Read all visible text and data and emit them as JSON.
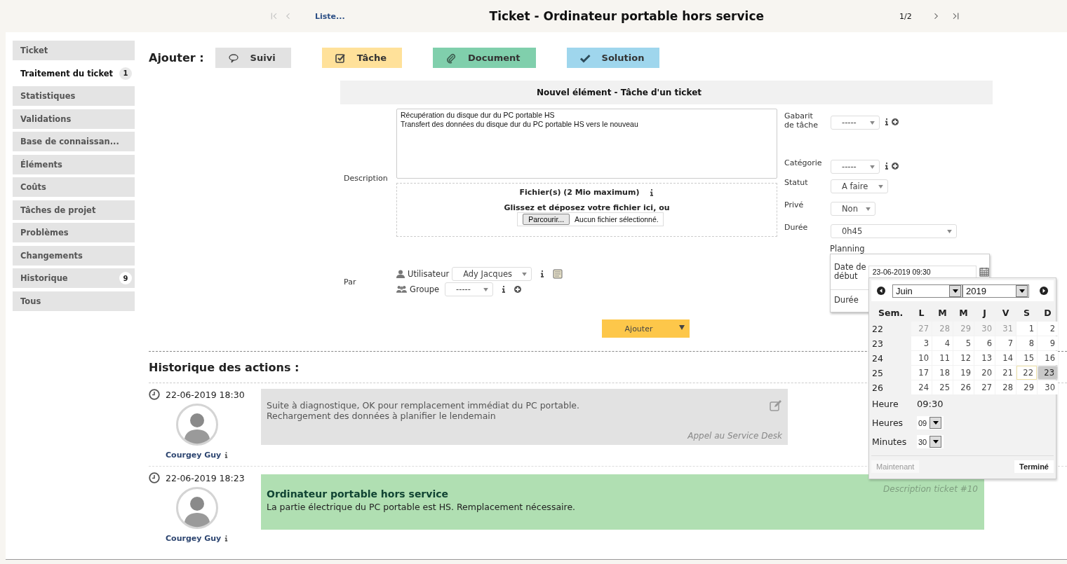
{
  "header": {
    "nav_left": [
      {
        "kind": "first",
        "disabled": true
      },
      {
        "kind": "prev",
        "disabled": true
      }
    ],
    "list_link": "Liste...",
    "title": "Ticket - Ordinateur portable hors service",
    "counter": "1/2",
    "nav_right": [
      {
        "kind": "next",
        "disabled": false
      },
      {
        "kind": "last",
        "disabled": false
      }
    ]
  },
  "sidebar": {
    "items": [
      {
        "label": "Ticket",
        "selected": false
      },
      {
        "label": "Traitement du ticket",
        "badge": "1",
        "selected": true
      },
      {
        "label": "Statistiques",
        "selected": false
      },
      {
        "label": "Validations",
        "selected": false
      },
      {
        "label": "Base de connaissan...",
        "selected": false
      },
      {
        "label": "Éléments",
        "selected": false
      },
      {
        "label": "Coûts",
        "selected": false
      },
      {
        "label": "Tâches de projet",
        "selected": false
      },
      {
        "label": "Problèmes",
        "selected": false
      },
      {
        "label": "Changements",
        "selected": false
      },
      {
        "label": "Historique",
        "badge": "9",
        "selected": false
      },
      {
        "label": "Tous",
        "selected": false
      }
    ]
  },
  "add_bar": {
    "label": "Ajouter :",
    "buttons": [
      {
        "label": "Suivi",
        "kind": "followup",
        "color": "#e2e2e2"
      },
      {
        "label": "Tâche",
        "kind": "task",
        "color": "#ffe19a"
      },
      {
        "label": "Document",
        "kind": "document",
        "color": "#80cfac"
      },
      {
        "label": "Solution",
        "kind": "solution",
        "color": "#9fd6ed"
      }
    ]
  },
  "form": {
    "title": "Nouvel élément - Tâche d'un ticket",
    "description_label": "Description",
    "description": "Récupération du disque dur du PC portable HS\nTransfert des données du disque dur du PC portable HS vers le nouveau",
    "files_title": "Fichier(s) (2 Mio maximum)",
    "drop_text": "Glissez et déposez votre fichier ici, ou",
    "browse_button": "Parcourir...",
    "no_file": "Aucun fichier sélectionné.",
    "by_label": "Par",
    "user_label": "Utilisateur",
    "user_value": "Ady Jacques",
    "group_label": "Groupe",
    "group_value": "-----",
    "fields": [
      {
        "label": "Gabarit de tâche",
        "value": "-----",
        "info": true,
        "add": true
      },
      {
        "label": "Catégorie",
        "value": "-----",
        "info": true,
        "add": true
      },
      {
        "label": "Statut",
        "value": "A faire",
        "info": false,
        "add": false
      },
      {
        "label": "Privé",
        "value": "Non",
        "info": false,
        "add": false
      },
      {
        "label": "Durée",
        "value": "0h45",
        "info": false,
        "add": false
      }
    ],
    "planning_label": "Planning",
    "start_label": "Date de début",
    "start_value": "23-06-2019 09:30",
    "duration_label": "Durée",
    "submit": "Ajouter"
  },
  "calendar": {
    "month": "Juin",
    "year": "2019",
    "headers": [
      "Sem.",
      "L",
      "M",
      "M",
      "J",
      "V",
      "S",
      "D"
    ],
    "weeks": [
      {
        "number": "22",
        "days": [
          {
            "label": "27",
            "other": true,
            "today": false,
            "selected": false
          },
          {
            "label": "28",
            "other": true,
            "today": false,
            "selected": false
          },
          {
            "label": "29",
            "other": true,
            "today": false,
            "selected": false
          },
          {
            "label": "30",
            "other": true,
            "today": false,
            "selected": false
          },
          {
            "label": "31",
            "other": true,
            "today": false,
            "selected": false
          },
          {
            "label": "1",
            "other": false,
            "today": false,
            "selected": false
          },
          {
            "label": "2",
            "other": false,
            "today": false,
            "selected": false
          }
        ]
      },
      {
        "number": "23",
        "days": [
          {
            "label": "3",
            "other": false,
            "today": false,
            "selected": false
          },
          {
            "label": "4",
            "other": false,
            "today": false,
            "selected": false
          },
          {
            "label": "5",
            "other": false,
            "today": false,
            "selected": false
          },
          {
            "label": "6",
            "other": false,
            "today": false,
            "selected": false
          },
          {
            "label": "7",
            "other": false,
            "today": false,
            "selected": false
          },
          {
            "label": "8",
            "other": false,
            "today": false,
            "selected": false
          },
          {
            "label": "9",
            "other": false,
            "today": false,
            "selected": false
          }
        ]
      },
      {
        "number": "24",
        "days": [
          {
            "label": "10",
            "other": false,
            "today": false,
            "selected": false
          },
          {
            "label": "11",
            "other": false,
            "today": false,
            "selected": false
          },
          {
            "label": "12",
            "other": false,
            "today": false,
            "selected": false
          },
          {
            "label": "13",
            "other": false,
            "today": false,
            "selected": false
          },
          {
            "label": "14",
            "other": false,
            "today": false,
            "selected": false
          },
          {
            "label": "15",
            "other": false,
            "today": false,
            "selected": false
          },
          {
            "label": "16",
            "other": false,
            "today": false,
            "selected": false
          }
        ]
      },
      {
        "number": "25",
        "days": [
          {
            "label": "17",
            "other": false,
            "today": false,
            "selected": false
          },
          {
            "label": "18",
            "other": false,
            "today": false,
            "selected": false
          },
          {
            "label": "19",
            "other": false,
            "today": false,
            "selected": false
          },
          {
            "label": "20",
            "other": false,
            "today": false,
            "selected": false
          },
          {
            "label": "21",
            "other": false,
            "today": false,
            "selected": false
          },
          {
            "label": "22",
            "other": false,
            "today": true,
            "selected": false
          },
          {
            "label": "23",
            "other": false,
            "today": false,
            "selected": true
          }
        ]
      },
      {
        "number": "26",
        "days": [
          {
            "label": "24",
            "other": false,
            "today": false,
            "selected": false
          },
          {
            "label": "25",
            "other": false,
            "today": false,
            "selected": false
          },
          {
            "label": "26",
            "other": false,
            "today": false,
            "selected": false
          },
          {
            "label": "27",
            "other": false,
            "today": false,
            "selected": false
          },
          {
            "label": "28",
            "other": false,
            "today": false,
            "selected": false
          },
          {
            "label": "29",
            "other": false,
            "today": false,
            "selected": false
          },
          {
            "label": "30",
            "other": false,
            "today": false,
            "selected": false
          }
        ]
      }
    ],
    "time_label": "Heure",
    "time": "09:30",
    "hours_label": "Heures",
    "hours": "09",
    "minutes_label": "Minutes",
    "minutes": "30",
    "now_button": "Maintenant",
    "done_button": "Terminé"
  },
  "history": {
    "title": "Historique des actions :",
    "entries": [
      {
        "kind": "followup",
        "date": "22-06-2019 18:30",
        "author": "Courgey Guy",
        "text": "Suite à diagnostique, OK pour remplacement immédiat du PC portable.\nRechargement des données à planifier le lendemain",
        "footer": "Appel au Service Desk"
      },
      {
        "kind": "description",
        "date": "22-06-2019 18:23",
        "author": "Courgey Guy",
        "heading": "Ordinateur portable hors service",
        "text": "La partie électrique du PC portable est HS. Remplacement nécessaire.",
        "footer": "Description ticket #10"
      }
    ]
  }
}
